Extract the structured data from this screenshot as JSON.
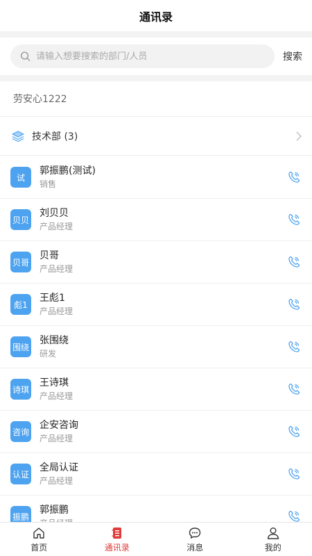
{
  "header": {
    "title": "通讯录"
  },
  "search": {
    "placeholder": "请输入想要搜索的部门/人员",
    "button_label": "搜索"
  },
  "company": {
    "name": "劳安心1222"
  },
  "department": {
    "label": "技术部 (3)"
  },
  "contacts": [
    {
      "avatar": "试",
      "name": "郭振鹏(测试)",
      "role": "销售"
    },
    {
      "avatar": "贝贝",
      "name": "刘贝贝",
      "role": "产品经理"
    },
    {
      "avatar": "贝哥",
      "name": "贝哥",
      "role": "产品经理"
    },
    {
      "avatar": "彪1",
      "name": "王彪1",
      "role": "产品经理"
    },
    {
      "avatar": "围绕",
      "name": "张围绕",
      "role": "研发"
    },
    {
      "avatar": "诗琪",
      "name": "王诗琪",
      "role": "产品经理"
    },
    {
      "avatar": "咨询",
      "name": "企安咨询",
      "role": "产品经理"
    },
    {
      "avatar": "认证",
      "name": "全局认证",
      "role": "产品经理"
    },
    {
      "avatar": "振鹏",
      "name": "郭振鹏",
      "role": "产品经理"
    }
  ],
  "tabbar": {
    "home": "首页",
    "contacts": "通讯录",
    "messages": "消息",
    "mine": "我的"
  },
  "colors": {
    "accent": "#4da3f0",
    "active_tab": "#e03a3a",
    "divider": "#eeeeee"
  }
}
